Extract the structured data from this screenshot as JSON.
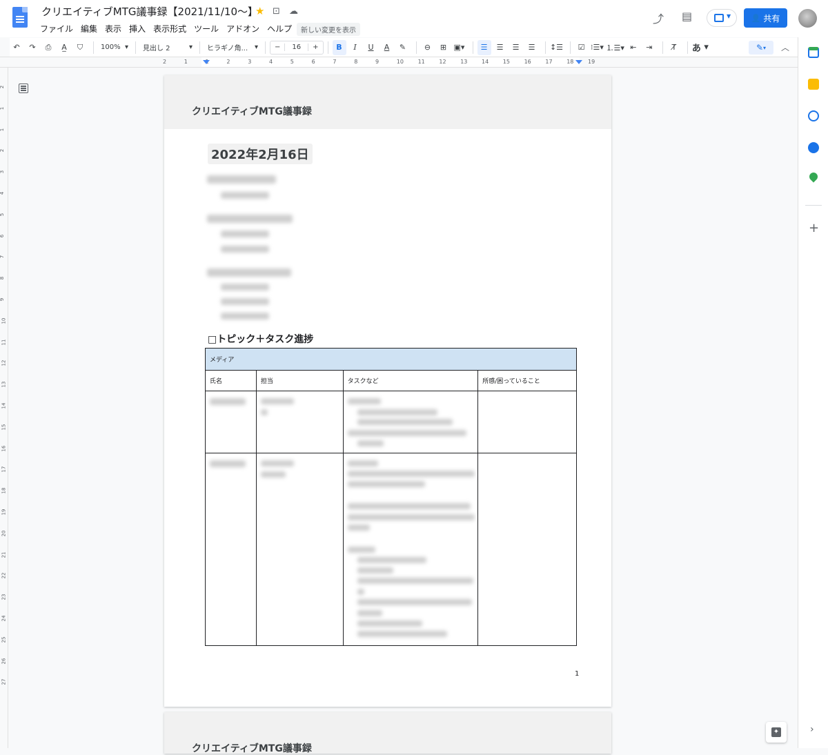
{
  "doc": {
    "title": "クリエイティブMTG議事録【2021/11/10〜】",
    "star_color": "#fbbc04"
  },
  "menu": [
    "ファイル",
    "編集",
    "表示",
    "挿入",
    "表示形式",
    "ツール",
    "アドオン",
    "ヘルプ"
  ],
  "last_edit": "新しい変更を表示",
  "share_label": "共有",
  "toolbar": {
    "zoom": "100%",
    "style": "見出し 2",
    "font": "ヒラギノ角...",
    "font_size": "16",
    "bold": "B",
    "italic": "I",
    "underline": "U",
    "text_color": "A",
    "input_tool": "あ"
  },
  "ruler": {
    "h_labels": [
      "2",
      "1",
      "1",
      "2",
      "3",
      "4",
      "5",
      "6",
      "7",
      "8",
      "9",
      "10",
      "11",
      "12",
      "13",
      "14",
      "15",
      "16",
      "17",
      "18",
      "19"
    ],
    "v_labels": [
      "2",
      "1",
      "1",
      "2",
      "3",
      "4",
      "5",
      "6",
      "7",
      "8",
      "9",
      "10",
      "11",
      "12",
      "13",
      "14",
      "15",
      "16",
      "17",
      "18",
      "19",
      "20",
      "21",
      "22",
      "23",
      "24",
      "25",
      "26",
      "27"
    ]
  },
  "page": {
    "header": "クリエイティブMTG議事録",
    "date_heading": "2022年2月16日",
    "topic_heading": "□トピック＋タスク進捗",
    "table": {
      "section": "メディア",
      "columns": [
        "氏名",
        "担当",
        "タスクなど",
        "所感/困っていること"
      ]
    },
    "page_number": "1"
  },
  "page2": {
    "header": "クリエイティブMTG議事録"
  },
  "side_panel": {
    "icons": [
      "calendar-icon",
      "keep-icon",
      "tasks-icon",
      "contacts-icon",
      "maps-icon"
    ]
  }
}
